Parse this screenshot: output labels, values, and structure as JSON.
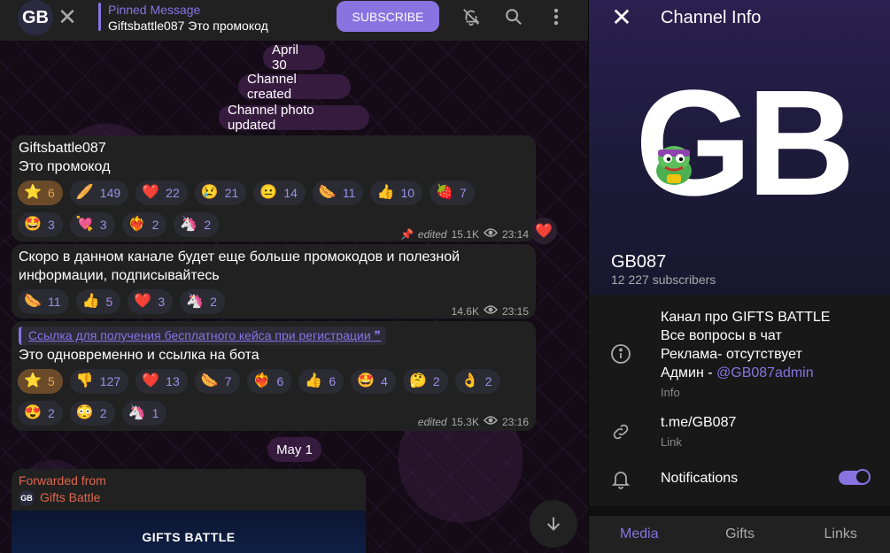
{
  "topbar": {
    "avatar_text": "GB",
    "pinned_title": "Pinned Message",
    "pinned_text": "Giftsbattle087 Это промокод",
    "subscribe": "SUBSCRIBE"
  },
  "dates": {
    "d1": "April 30",
    "d2": "May 1"
  },
  "service": {
    "created": "Channel created",
    "photo": "Channel photo updated"
  },
  "msg1": {
    "line1": "Giftsbattle087",
    "line2": "Это промокод",
    "reactions": [
      {
        "emoji": "⭐",
        "count": "6",
        "selected": true
      },
      {
        "emoji": "🥖",
        "count": "149"
      },
      {
        "emoji": "❤️",
        "count": "22"
      },
      {
        "emoji": "😢",
        "count": "21"
      },
      {
        "emoji": "😐",
        "count": "14"
      },
      {
        "emoji": "🌭",
        "count": "11"
      },
      {
        "emoji": "👍",
        "count": "10"
      },
      {
        "emoji": "🍓",
        "count": "7"
      },
      {
        "emoji": "🤩",
        "count": "3"
      },
      {
        "emoji": "💘",
        "count": "3"
      },
      {
        "emoji": "❤️‍🔥",
        "count": "2"
      },
      {
        "emoji": "🦄",
        "count": "2"
      }
    ],
    "edited": "edited",
    "views": "15.1K",
    "time": "23:14"
  },
  "msg2": {
    "line1": "Скоро в данном канале будет еще больше промокодов и полезной",
    "line2": "информации, подписывайтесь",
    "reactions": [
      {
        "emoji": "🌭",
        "count": "11"
      },
      {
        "emoji": "👍",
        "count": "5"
      },
      {
        "emoji": "❤️",
        "count": "3"
      },
      {
        "emoji": "🦄",
        "count": "2"
      }
    ],
    "views": "14.6K",
    "time": "23:15"
  },
  "msg3": {
    "link": "Ссылка для получения бесплатного кейса при регистрации",
    "line1": "Это одновременно и ссылка на бота",
    "reactions": [
      {
        "emoji": "⭐",
        "count": "5",
        "selected": true
      },
      {
        "emoji": "👎",
        "count": "127"
      },
      {
        "emoji": "❤️",
        "count": "13"
      },
      {
        "emoji": "🌭",
        "count": "7"
      },
      {
        "emoji": "❤️‍🔥",
        "count": "6"
      },
      {
        "emoji": "👍",
        "count": "6"
      },
      {
        "emoji": "🤩",
        "count": "4"
      },
      {
        "emoji": "🤔",
        "count": "2"
      },
      {
        "emoji": "👌",
        "count": "2"
      },
      {
        "emoji": "😍",
        "count": "2"
      },
      {
        "emoji": "😳",
        "count": "2"
      },
      {
        "emoji": "🦄",
        "count": "1"
      }
    ],
    "edited": "edited",
    "views": "15.3K",
    "time": "23:16"
  },
  "fwd": {
    "label": "Forwarded from",
    "avatar_text": "GB",
    "name": "Gifts Battle",
    "banner": "GIFTS BATTLE"
  },
  "info": {
    "title": "Channel Info",
    "logo": "GB",
    "name": "GB087",
    "subscribers": "12 227 subscribers",
    "desc1": "Канал про GIFTS BATTLE",
    "desc2": "Все вопросы в чат",
    "desc3": "Реклама- отсутствует",
    "desc4_prefix": "Админ - ",
    "desc4_link": "@GB087admin",
    "info_label": "Info",
    "link": "t.me/GB087",
    "link_label": "Link",
    "notifications": "Notifications",
    "notifications_on": true,
    "tabs": [
      "Media",
      "Gifts",
      "Links"
    ]
  },
  "colors": {
    "accent": "#8774e1",
    "forward": "#e0664c",
    "bubble": "#212121"
  }
}
